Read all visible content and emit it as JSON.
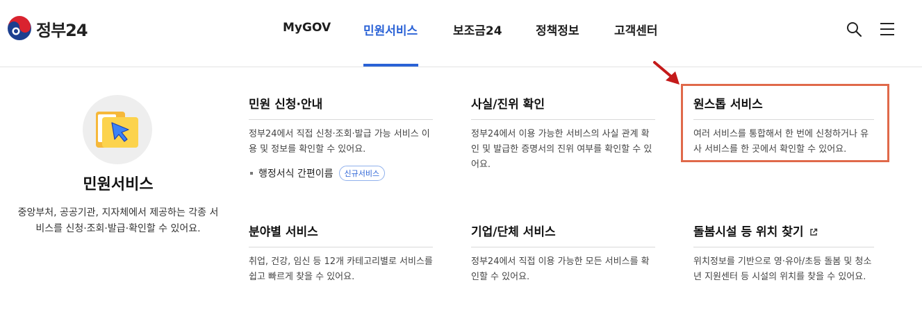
{
  "header": {
    "logo_text": "정부24",
    "nav": [
      {
        "label": "MyGOV"
      },
      {
        "label": "민원서비스"
      },
      {
        "label": "보조금24"
      },
      {
        "label": "정책정보"
      },
      {
        "label": "고객센터"
      }
    ],
    "active_tab": "민원서비스"
  },
  "left_panel": {
    "title": "민원서비스",
    "description": "중앙부처, 공공기관, 지자체에서 제공하는 각종 서비스를 신청·조회·발급·확인할 수 있어요."
  },
  "cards": [
    {
      "title": "민원 신청·안내",
      "description": "정부24에서 직접 신청·조회·발급 가능 서비스 이용 및 정보를 확인할 수 있어요.",
      "link_label": "행정서식 간편이름",
      "badge": "신규서비스"
    },
    {
      "title": "사실/진위 확인",
      "description": "정부24에서 이용 가능한 서비스의 사실 관계 확인 및 발급한 증명서의 진위 여부를 확인할 수 있어요."
    },
    {
      "title": "원스톱 서비스",
      "description": "여러 서비스를 통합해서 한 번에 신청하거나 유사 서비스를 한 곳에서 확인할 수 있어요."
    },
    {
      "title": "분야별 서비스",
      "description": "취업, 건강, 임신 등 12개 카테고리별로 서비스를 쉽고 빠르게 찾을 수 있어요."
    },
    {
      "title": "기업/단체 서비스",
      "description": "정부24에서 직접 이용 가능한 모든 서비스를 확인할 수 있어요."
    },
    {
      "title": "돌봄시설 등 위치 찾기",
      "description": "위치정보를 기반으로 영·유아/초등 돌봄 및 청소년 지원센터 등 시설의 위치를 찾을 수 있어요."
    }
  ],
  "colors": {
    "accent": "#2a62d6",
    "highlight_box": "#e0694a",
    "annotation_arrow": "#c41a1a"
  },
  "icons": [
    "search-icon",
    "menu-icon",
    "external-link-icon",
    "folder-cursor-icon",
    "arrow-annotation-icon"
  ]
}
